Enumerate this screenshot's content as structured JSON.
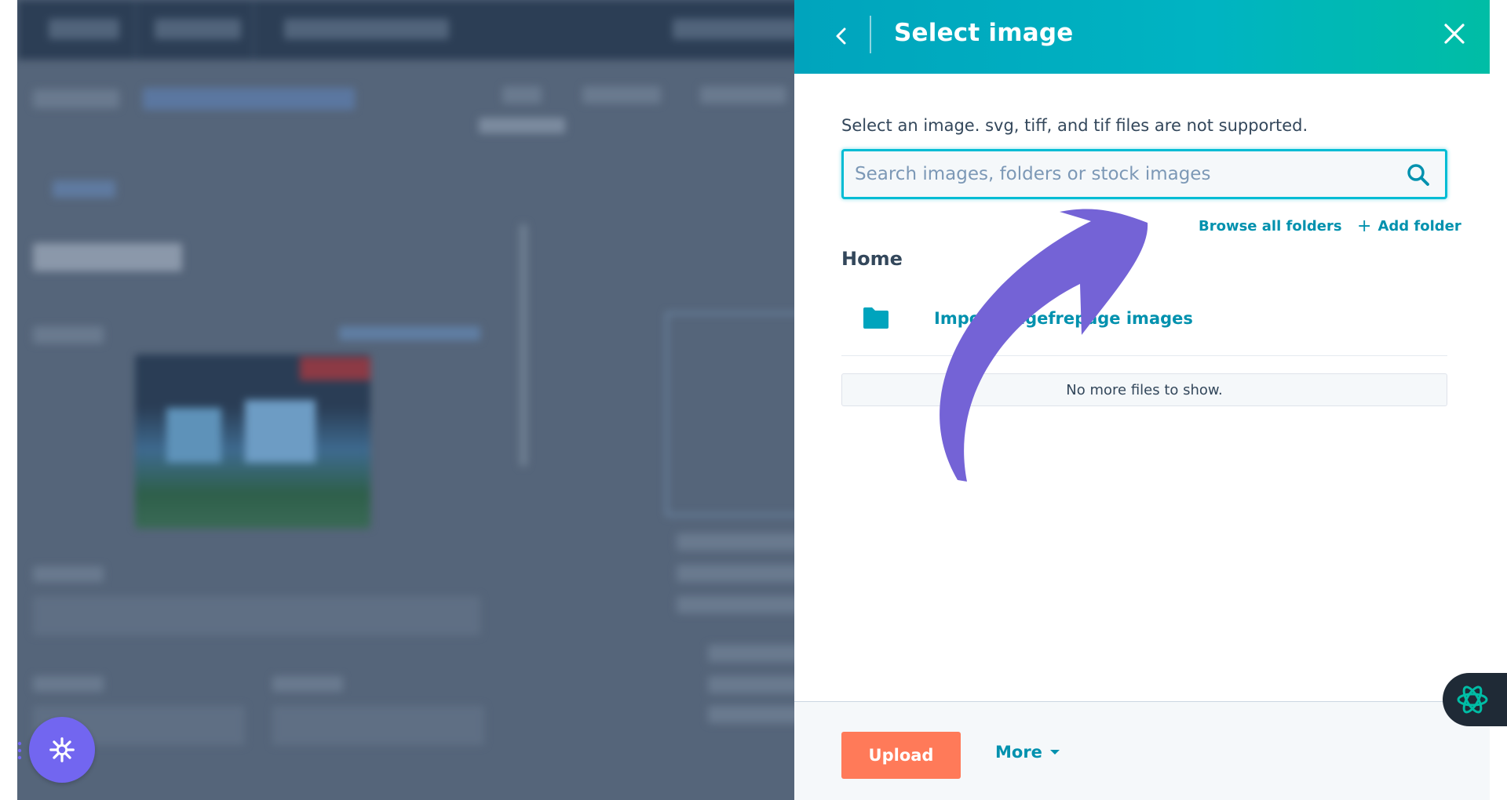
{
  "panel": {
    "title": "Select image",
    "instructions": "Select an image. svg, tiff, and tif files are not supported.",
    "search_placeholder": "Search images, folders or stock images",
    "browse_all_folders": "Browse all folders",
    "add_folder": "Add folder",
    "add_folder_symbol": "+",
    "section_heading": "Home",
    "folders": [
      {
        "name": "Import pagefrepage images"
      }
    ],
    "empty_message": "No more files to show.",
    "footer": {
      "upload_label": "Upload",
      "more_label": "More"
    }
  },
  "colors": {
    "header_gradient_start": "#00a4bd",
    "header_gradient_end": "#00bda5",
    "link": "#0091ae",
    "upload_button": "#ff7a59",
    "annotation_arrow": "#7463d6",
    "fab": "#7266f0"
  },
  "icons": {
    "back": "chevron-left-icon",
    "close": "close-icon",
    "search": "search-icon",
    "folder": "folder-icon",
    "ai_assistant": "ai-spark-icon",
    "fab": "snowflake-icon"
  }
}
